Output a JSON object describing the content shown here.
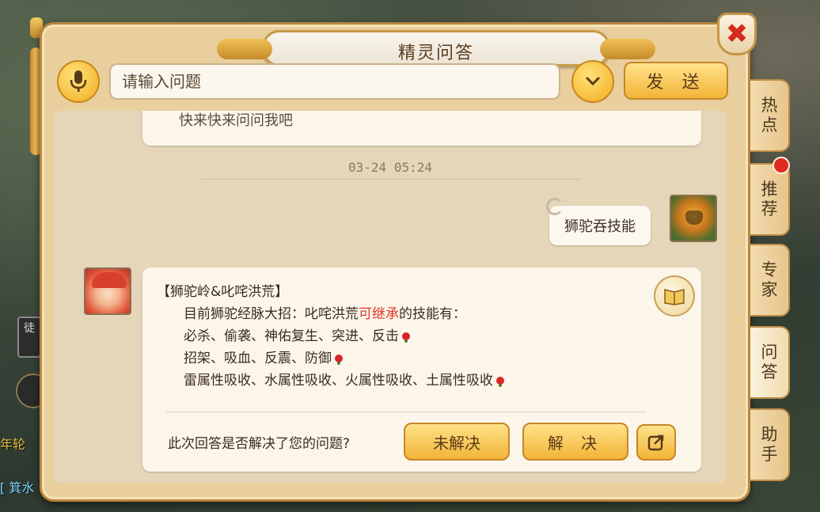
{
  "window": {
    "title": "精灵问答",
    "close_icon": "close-icon"
  },
  "input_row": {
    "placeholder": "请输入问题",
    "send_label": "发 送",
    "mic_icon": "microphone-icon",
    "dropdown_icon": "chevron-down-icon"
  },
  "chat": {
    "prev_text": "快来快来问问我吧",
    "timestamp": "03-24 05:24",
    "user_message": "狮驼吞技能",
    "bot": {
      "title": "【狮驼岭&叱咤洪荒】",
      "line1_pre": "目前狮驼经脉大招：叱咤洪荒",
      "line1_hl": "可继承",
      "line1_post": "的技能有：",
      "line2": "必杀、偷袭、神佑复生、突进、反击",
      "line3": "招架、吸血、反震、防御",
      "line4": "雷属性吸收、水属性吸收、火属性吸收、土属性吸收",
      "question": "此次回答是否解决了您的问题?",
      "unsolved_label": "未解决",
      "solved_label": "解 决"
    }
  },
  "side_tabs": [
    {
      "label_top": "热",
      "label_bottom": "点"
    },
    {
      "label_top": "推",
      "label_bottom": "荐"
    },
    {
      "label_top": "专",
      "label_bottom": "家"
    },
    {
      "label_top": "问",
      "label_bottom": "答"
    },
    {
      "label_top": "助",
      "label_bottom": "手"
    }
  ],
  "background": {
    "tile_text": "徒",
    "left_text1": "年轮",
    "left_text2": "[ 箕水"
  },
  "colors": {
    "accent_gold": "#f2b437",
    "highlight_red": "#e0352a",
    "panel": "#e9cf9d"
  }
}
